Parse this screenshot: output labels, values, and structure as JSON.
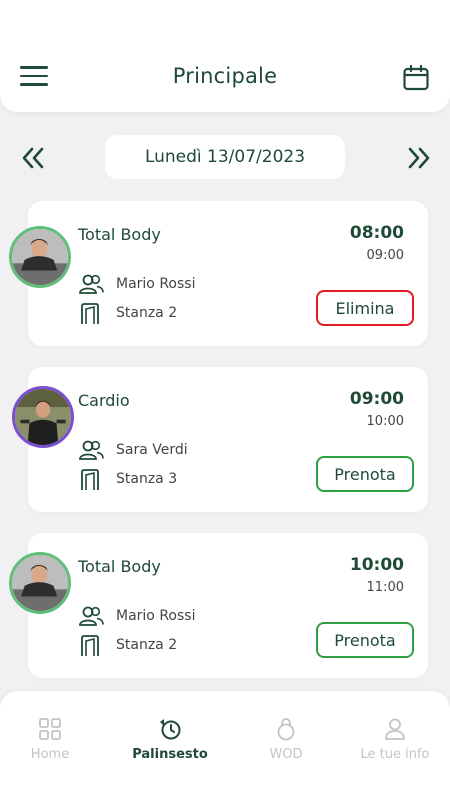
{
  "header": {
    "title": "Principale",
    "menu_icon": "hamburger-menu-icon",
    "calendar_icon": "calendar-icon"
  },
  "date_nav": {
    "current_date": "Lunedì 13/07/2023",
    "prev_icon": "double-chevron-left-icon",
    "next_icon": "double-chevron-right-icon"
  },
  "classes": [
    {
      "name": "Total Body",
      "start": "08:00",
      "end": "09:00",
      "instructor": "Mario Rossi",
      "room": "Stanza 2",
      "action": "Elimina",
      "action_type": "delete",
      "avatar_ring": "#5fc07a"
    },
    {
      "name": "Cardio",
      "start": "09:00",
      "end": "10:00",
      "instructor": "Sara Verdi",
      "room": "Stanza 3",
      "action": "Prenota",
      "action_type": "book",
      "avatar_ring": "#7a4fd3"
    },
    {
      "name": "Total Body",
      "start": "10:00",
      "end": "11:00",
      "instructor": "Mario Rossi",
      "room": "Stanza 2",
      "action": "Prenota",
      "action_type": "book",
      "avatar_ring": "#5fc07a"
    }
  ],
  "bottom_nav": {
    "items": [
      {
        "label": "Home",
        "icon": "grid-icon",
        "active": false
      },
      {
        "label": "Palinsesto",
        "icon": "schedule-icon",
        "active": true
      },
      {
        "label": "WOD",
        "icon": "kettlebell-icon",
        "active": false
      },
      {
        "label": "Le tue info",
        "icon": "user-icon",
        "active": false
      }
    ]
  },
  "colors": {
    "primary": "#1f4a36",
    "delete": "#e01b24",
    "book": "#2ea043",
    "background": "#f1f1f3",
    "inactive": "#c4c4c4"
  }
}
